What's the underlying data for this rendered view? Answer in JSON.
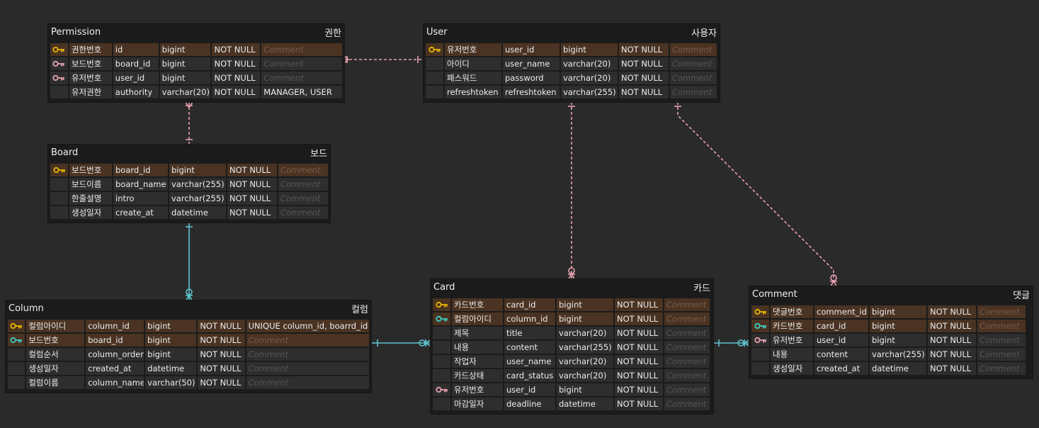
{
  "colors": {
    "pk_key": "#e8b400",
    "fk_key_pink": "#e8a0b0",
    "fk_key_teal": "#3ecfc4",
    "line_pink": "#e8a0b0",
    "line_teal": "#5ec4d0"
  },
  "tables": {
    "permission": {
      "name": "Permission",
      "label": "권한",
      "rows": [
        {
          "key": "pk",
          "logical": "권한번호",
          "physical": "id",
          "type": "bigint",
          "null": "NOT NULL",
          "comment": "Comment"
        },
        {
          "key": "fk",
          "logical": "보드번호",
          "physical": "board_id",
          "type": "bigint",
          "null": "NOT NULL",
          "comment": "Comment"
        },
        {
          "key": "fk",
          "logical": "유저번호",
          "physical": "user_id",
          "type": "bigint",
          "null": "NOT NULL",
          "comment": "Comment"
        },
        {
          "key": "",
          "logical": "유저권한",
          "physical": "authority",
          "type": "varchar(20)",
          "null": "NOT NULL",
          "comment": "MANAGER, USER"
        }
      ]
    },
    "user": {
      "name": "User",
      "label": "사용자",
      "rows": [
        {
          "key": "pk",
          "logical": "유저번호",
          "physical": "user_id",
          "type": "bigint",
          "null": "NOT NULL",
          "comment": "Comment"
        },
        {
          "key": "",
          "logical": "아이디",
          "physical": "user_name",
          "type": "varchar(20)",
          "null": "NOT NULL",
          "comment": "Comment"
        },
        {
          "key": "",
          "logical": "패스워드",
          "physical": "password",
          "type": "varchar(20)",
          "null": "NOT NULL",
          "comment": "Comment"
        },
        {
          "key": "",
          "logical": "refreshtoken",
          "physical": "refreshtoken",
          "type": "varchar(255)",
          "null": "NOT NULL",
          "comment": "Comment"
        }
      ]
    },
    "board": {
      "name": "Board",
      "label": "보드",
      "rows": [
        {
          "key": "pk",
          "logical": "보드번호",
          "physical": "board_id",
          "type": "bigint",
          "null": "NOT NULL",
          "comment": "Comment"
        },
        {
          "key": "",
          "logical": "보드이름",
          "physical": "board_name",
          "type": "varchar(255)",
          "null": "NOT NULL",
          "comment": "Comment"
        },
        {
          "key": "",
          "logical": "한줄설명",
          "physical": "intro",
          "type": "varchar(255)",
          "null": "NOT NULL",
          "comment": "Comment"
        },
        {
          "key": "",
          "logical": "생성일자",
          "physical": "create_at",
          "type": "datetime",
          "null": "NOT NULL",
          "comment": "Comment"
        }
      ]
    },
    "column": {
      "name": "Column",
      "label": "컬럼",
      "rows": [
        {
          "key": "pk",
          "logical": "컬럼아이디",
          "physical": "column_id",
          "type": "bigint",
          "null": "NOT NULL",
          "comment": "UNIQUE column_id, boarrd_id"
        },
        {
          "key": "pfk",
          "logical": "보드번호",
          "physical": "board_id",
          "type": "bigint",
          "null": "NOT NULL",
          "comment": "Comment"
        },
        {
          "key": "",
          "logical": "컬럼순서",
          "physical": "column_order",
          "type": "bigint",
          "null": "NOT NULL",
          "comment": "Comment"
        },
        {
          "key": "",
          "logical": "생성일자",
          "physical": "created_at",
          "type": "datetime",
          "null": "NOT NULL",
          "comment": "Comment"
        },
        {
          "key": "",
          "logical": "컬럼이름",
          "physical": "column_name",
          "type": "varchar(50)",
          "null": "NOT NULL",
          "comment": "Comment"
        }
      ]
    },
    "card": {
      "name": "Card",
      "label": "카드",
      "rows": [
        {
          "key": "pk",
          "logical": "카드번호",
          "physical": "card_id",
          "type": "bigint",
          "null": "NOT NULL",
          "comment": "Comment"
        },
        {
          "key": "pfk",
          "logical": "컬럼아이디",
          "physical": "column_id",
          "type": "bigint",
          "null": "NOT NULL",
          "comment": "Comment"
        },
        {
          "key": "",
          "logical": "제목",
          "physical": "title",
          "type": "varchar(20)",
          "null": "NOT NULL",
          "comment": "Comment"
        },
        {
          "key": "",
          "logical": "내용",
          "physical": "content",
          "type": "varchar(255)",
          "null": "NOT NULL",
          "comment": "Comment"
        },
        {
          "key": "",
          "logical": "작업자",
          "physical": "user_name",
          "type": "varchar(20)",
          "null": "NOT NULL",
          "comment": "Comment"
        },
        {
          "key": "",
          "logical": "카드상태",
          "physical": "card_status",
          "type": "varchar(20)",
          "null": "NOT NULL",
          "comment": "Comment"
        },
        {
          "key": "fk",
          "logical": "유저번호",
          "physical": "user_id",
          "type": "bigint",
          "null": "NOT NULL",
          "comment": "Comment"
        },
        {
          "key": "",
          "logical": "마감일자",
          "physical": "deadline",
          "type": "datetime",
          "null": "NOT NULL",
          "comment": "Comment"
        }
      ]
    },
    "comment": {
      "name": "Comment",
      "label": "댓글",
      "rows": [
        {
          "key": "pk",
          "logical": "댓글번호",
          "physical": "comment_id",
          "type": "bigint",
          "null": "NOT NULL",
          "comment": "Comment"
        },
        {
          "key": "pfk",
          "logical": "카드번호",
          "physical": "card_id",
          "type": "bigint",
          "null": "NOT NULL",
          "comment": "Comment"
        },
        {
          "key": "fk",
          "logical": "유저번호",
          "physical": "user_id",
          "type": "bigint",
          "null": "NOT NULL",
          "comment": "Comment"
        },
        {
          "key": "",
          "logical": "내용",
          "physical": "content",
          "type": "varchar(255)",
          "null": "NOT NULL",
          "comment": "Comment"
        },
        {
          "key": "",
          "logical": "생성일자",
          "physical": "created_at",
          "type": "datetime",
          "null": "NOT NULL",
          "comment": "Comment"
        }
      ]
    }
  }
}
